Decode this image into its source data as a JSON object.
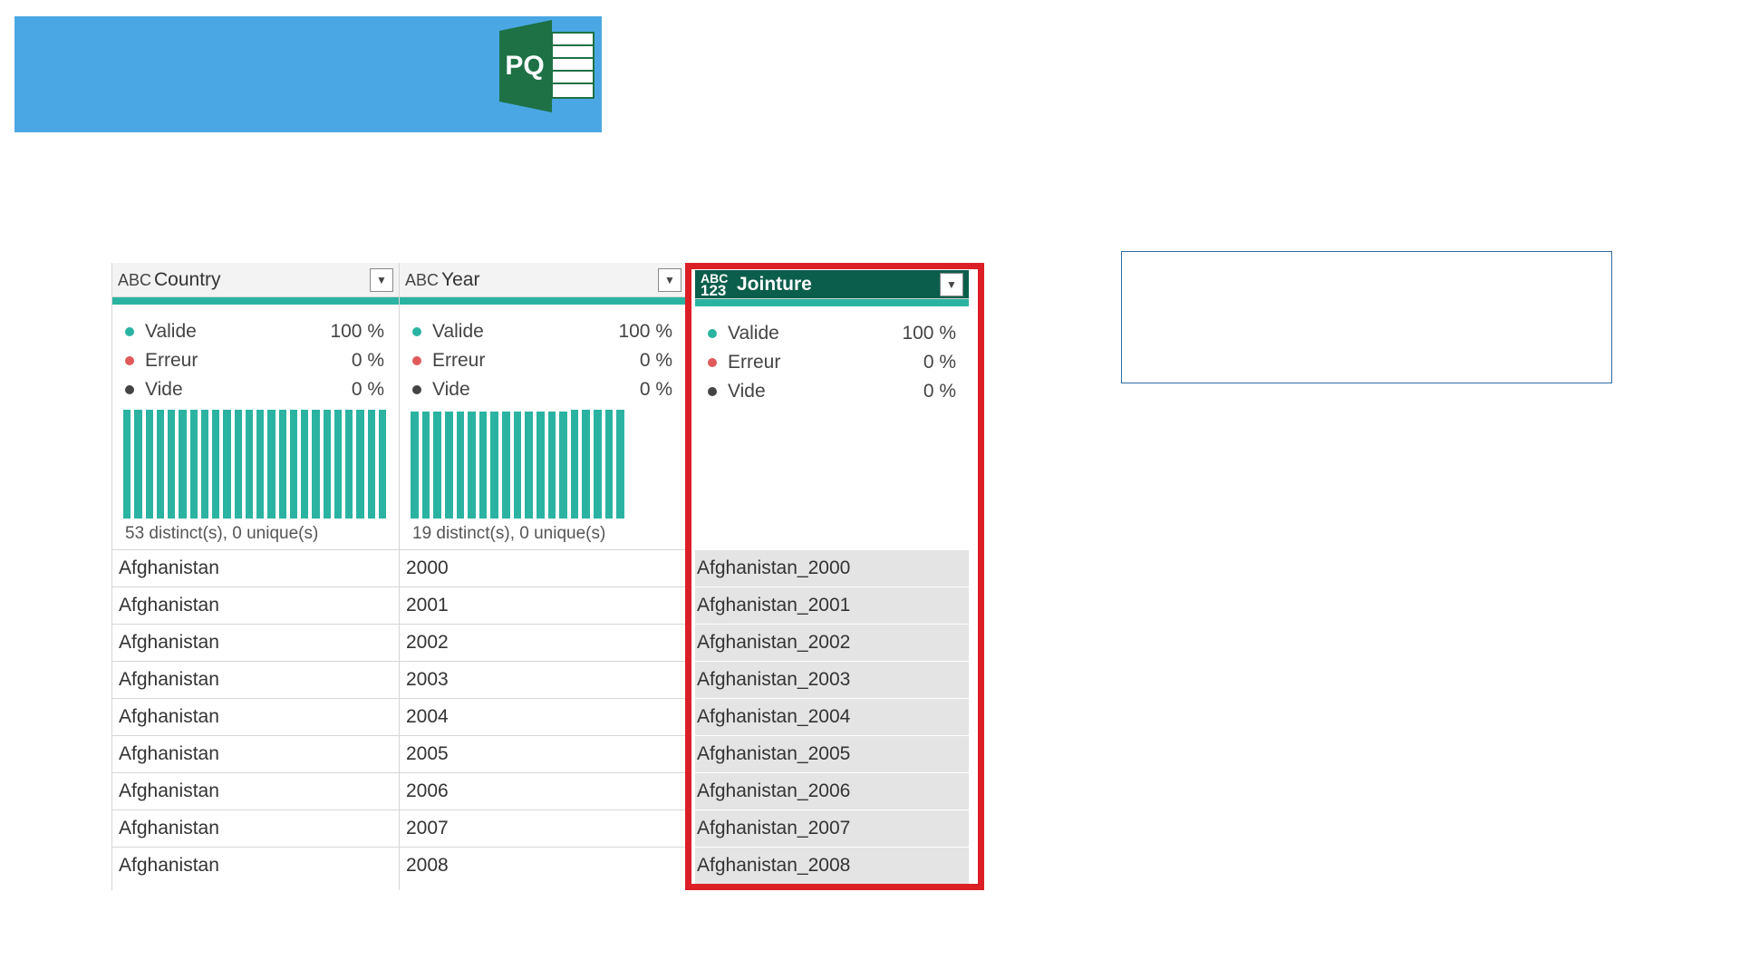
{
  "banner": {
    "logo_text": "PQ",
    "color": "#4aa7e3",
    "logo_color": "#1e7145"
  },
  "columns": [
    {
      "name": "Country",
      "type_icon": "ABC-text-type-icon",
      "type_label": "ABC",
      "stats": {
        "valid_label": "Valide",
        "valid": "100 %",
        "error_label": "Erreur",
        "error": "0 %",
        "empty_label": "Vide",
        "empty": "0 %"
      },
      "distinct": "53 distinct(s), 0 unique(s)",
      "distribution_fraction": [
        1,
        1,
        1,
        1,
        1,
        1,
        1,
        1,
        1,
        1,
        1,
        1,
        1,
        1,
        1,
        1,
        1,
        1,
        1,
        1,
        1,
        1,
        1,
        1
      ],
      "rows": [
        "Afghanistan",
        "Afghanistan",
        "Afghanistan",
        "Afghanistan",
        "Afghanistan",
        "Afghanistan",
        "Afghanistan",
        "Afghanistan",
        "Afghanistan"
      ]
    },
    {
      "name": "Year",
      "type_icon": "ABC-text-type-icon",
      "type_label": "ABC",
      "stats": {
        "valid_label": "Valide",
        "valid": "100 %",
        "error_label": "Erreur",
        "error": "0 %",
        "empty_label": "Vide",
        "empty": "0 %"
      },
      "distinct": "19 distinct(s), 0 unique(s)",
      "distribution_fraction": [
        0.98,
        0.98,
        0.98,
        0.98,
        0.98,
        0.98,
        0.98,
        0.98,
        0.98,
        0.98,
        0.98,
        0.98,
        0.98,
        0.98,
        1,
        1,
        1,
        1,
        1
      ],
      "rows": [
        "2000",
        "2001",
        "2002",
        "2003",
        "2004",
        "2005",
        "2006",
        "2007",
        "2008"
      ]
    },
    {
      "name": "Jointure",
      "type_icon": "ABC123-any-type-icon",
      "type_label_top": "ABC",
      "type_label_bottom": "123",
      "stats": {
        "valid_label": "Valide",
        "valid": "100 %",
        "error_label": "Erreur",
        "error": "0 %",
        "empty_label": "Vide",
        "empty": "0 %"
      },
      "rows": [
        "Afghanistan_2000",
        "Afghanistan_2001",
        "Afghanistan_2002",
        "Afghanistan_2003",
        "Afghanistan_2004",
        "Afghanistan_2005",
        "Afghanistan_2006",
        "Afghanistan_2007",
        "Afghanistan_2008"
      ]
    }
  ],
  "colors": {
    "teal": "#2bb3a2",
    "selected_header": "#0b5e4c",
    "highlight_frame": "#dc1e27",
    "valid_dot": "#2bb3a2",
    "error_dot": "#e05a5a",
    "empty_dot": "#444444"
  }
}
